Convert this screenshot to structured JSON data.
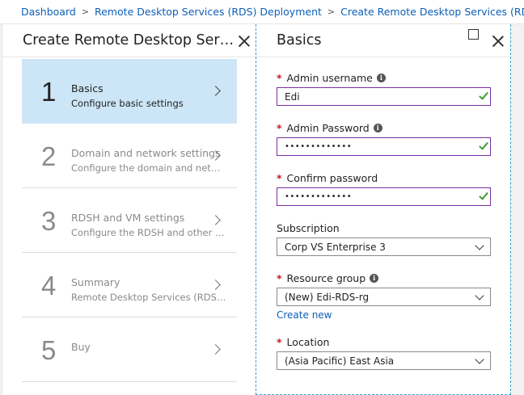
{
  "breadcrumb": [
    {
      "label": "Dashboard"
    },
    {
      "label": "Remote Desktop Services (RDS) Deployment"
    },
    {
      "label": "Create Remote Desktop Services (RDS) Deployment"
    }
  ],
  "left_blade": {
    "title": "Create Remote Desktop Servi...",
    "steps": [
      {
        "number": "1",
        "title": "Basics",
        "subtitle": "Configure basic settings",
        "state": "active"
      },
      {
        "number": "2",
        "title": "Domain and network settings",
        "subtitle": "Configure the domain and network",
        "state": "disabled"
      },
      {
        "number": "3",
        "title": "RDSH and VM settings",
        "subtitle": "Configure the RDSH and other VMs",
        "state": "disabled"
      },
      {
        "number": "4",
        "title": "Summary",
        "subtitle": "Remote Desktop Services (RDS) D...",
        "state": "disabled"
      },
      {
        "number": "5",
        "title": "Buy",
        "subtitle": "",
        "state": "disabled"
      }
    ]
  },
  "right_blade": {
    "title": "Basics",
    "fields": {
      "admin_username": {
        "label": "Admin username",
        "value": "Edi"
      },
      "admin_password": {
        "label": "Admin Password",
        "value": "•••••••••••••"
      },
      "confirm_password": {
        "label": "Confirm password",
        "value": "•••••••••••••"
      },
      "subscription": {
        "label": "Subscription",
        "value": "Corp VS Enterprise 3"
      },
      "resource_group": {
        "label": "Resource group",
        "value": "(New) Edi-RDS-rg",
        "link": "Create new"
      },
      "location": {
        "label": "Location",
        "value": "(Asia Pacific) East Asia"
      }
    }
  },
  "colors": {
    "link": "#0d5fb8",
    "active_step_bg": "#cde6f7",
    "required": "#d01818",
    "valid_border": "#7a2fa3",
    "check": "#3f9c35"
  }
}
